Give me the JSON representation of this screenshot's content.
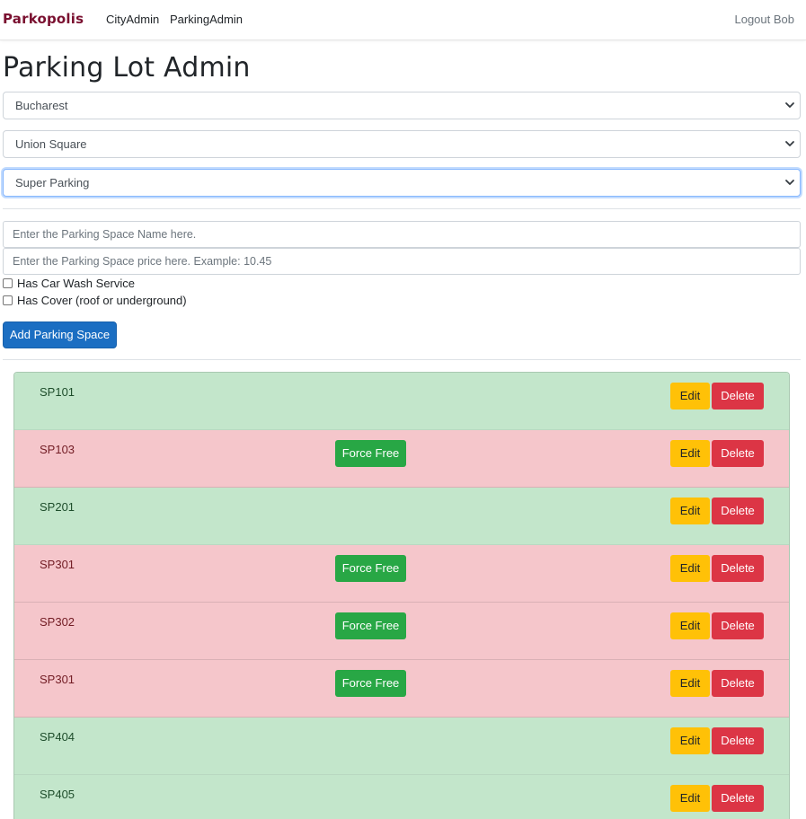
{
  "navbar": {
    "brand": "Parkopolis",
    "links": [
      "CityAdmin",
      "ParkingAdmin"
    ],
    "logout": "Logout Bob"
  },
  "page_title": "Parking Lot Admin",
  "selects": {
    "city": "Bucharest",
    "area": "Union Square",
    "lot": "Super Parking"
  },
  "form": {
    "name_placeholder": "Enter the Parking Space Name here.",
    "price_placeholder": "Enter the Parking Space price here. Example: 10.45",
    "car_wash_label": "Has Car Wash Service",
    "cover_label": "Has Cover (roof or underground)",
    "car_wash_checked": false,
    "cover_checked": false,
    "add_button": "Add Parking Space"
  },
  "labels": {
    "force_free": "Force Free",
    "edit": "Edit",
    "delete": "Delete"
  },
  "colors": {
    "free_row": "#c3e6cb",
    "occupied_row": "#f5c6cb",
    "primary": "#1b6ec2",
    "success": "#28a745",
    "warning": "#ffc107",
    "danger": "#dc3545"
  },
  "spaces": [
    {
      "name": "SP101",
      "occupied": false
    },
    {
      "name": "SP103",
      "occupied": true
    },
    {
      "name": "SP201",
      "occupied": false
    },
    {
      "name": "SP301",
      "occupied": true
    },
    {
      "name": "SP302",
      "occupied": true
    },
    {
      "name": "SP301",
      "occupied": true
    },
    {
      "name": "SP404",
      "occupied": false
    },
    {
      "name": "SP405",
      "occupied": false
    }
  ]
}
